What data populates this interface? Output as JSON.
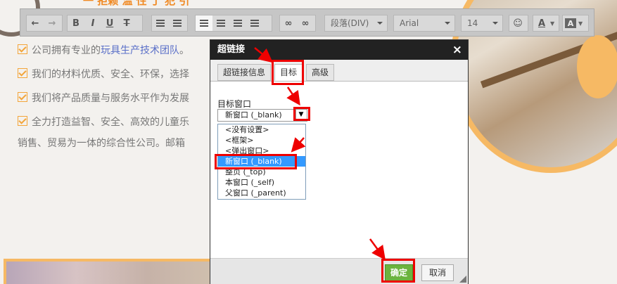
{
  "background": {
    "header_partial": "一 拒赖 温 性 丁 犯 引",
    "bullets": [
      {
        "text_before": "公司拥有专业的",
        "highlight": "玩具生产技术团队",
        "text_after": "。"
      },
      {
        "text_before": "我们的材料优质、安全、环保，选择",
        "highlight": "",
        "text_after": ""
      },
      {
        "text_before": "我们将产品质量与服务水平作为发展",
        "highlight": "",
        "text_after": ""
      },
      {
        "text_before": "全力打造益智、安全、高效的儿童乐",
        "highlight": "",
        "text_after": ""
      }
    ],
    "line5": "销售、贸易为一体的综合性公司。邮箱"
  },
  "toolbar": {
    "paragraph_select": "段落(DIV)",
    "font_select": "Arial",
    "size_select": "14",
    "icons": [
      "undo-icon",
      "redo-icon",
      "bold-icon",
      "italic-icon",
      "underline-icon",
      "clear-format-icon",
      "ordered-list-icon",
      "unordered-list-icon",
      "align-left-icon",
      "align-center-icon",
      "align-right-icon",
      "justify-icon",
      "link-icon",
      "unlink-icon",
      "emoji-icon",
      "font-color-icon",
      "background-color-icon"
    ],
    "bold": "B",
    "italic": "I",
    "underline": "U",
    "font_color_letter": "A",
    "bg_color_letter": "A"
  },
  "dialog": {
    "title": "超链接",
    "close": "×",
    "tabs": [
      {
        "label": "超链接信息",
        "selected": false
      },
      {
        "label": "目标",
        "selected": true
      },
      {
        "label": "高级",
        "selected": false
      }
    ],
    "field_label": "目标窗口",
    "select_value": "新窗口 (_blank)",
    "select_button": "▼",
    "options": [
      {
        "label": "<没有设置>",
        "highlighted": false
      },
      {
        "label": "<框架>",
        "highlighted": false
      },
      {
        "label": "<弹出窗口>",
        "highlighted": false
      },
      {
        "label": "新窗口 (_blank)",
        "highlighted": true
      },
      {
        "label": "整页 (_top)",
        "highlighted": false
      },
      {
        "label": "本窗口 (_self)",
        "highlighted": false
      },
      {
        "label": "父窗口 (_parent)",
        "highlighted": false
      }
    ],
    "ok": "确定",
    "cancel": "取消"
  },
  "colors": {
    "accent_orange": "#f08a24",
    "annotation_red": "#e00000",
    "ok_green": "#6cb33e",
    "highlight_blue": "#3399ff"
  }
}
